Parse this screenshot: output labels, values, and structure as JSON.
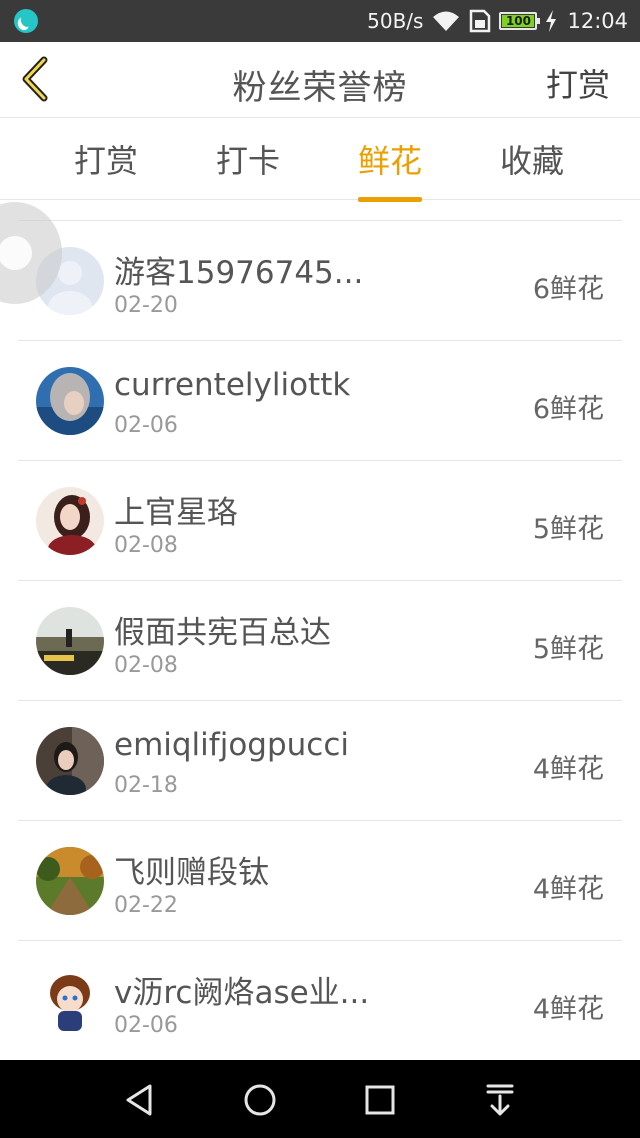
{
  "status_bar": {
    "speed": "50B/s",
    "battery": "100",
    "time": "12:04",
    "icons": [
      "app-notification-icon",
      "wifi-icon",
      "sim-icon",
      "battery-icon",
      "charging-icon"
    ]
  },
  "header": {
    "title": "粉丝荣誉榜",
    "action_label": "打赏",
    "back_icon": "chevron-left-icon"
  },
  "tabs": [
    {
      "label": "打赏",
      "active": false
    },
    {
      "label": "打卡",
      "active": false
    },
    {
      "label": "鲜花",
      "active": true
    },
    {
      "label": "收藏",
      "active": false
    }
  ],
  "colors": {
    "accent": "#e9a000",
    "status_bar": "#3a3a3a",
    "nav_bar": "#000000"
  },
  "rows": [
    {
      "name": "游客15976745...",
      "date": "02-20",
      "count": "6鲜花"
    },
    {
      "name": "currentelyliottk",
      "date": "02-06",
      "count": "6鲜花"
    },
    {
      "name": "上官星珞",
      "date": "02-08",
      "count": "5鲜花"
    },
    {
      "name": "假面共宪百总达",
      "date": "02-08",
      "count": "5鲜花"
    },
    {
      "name": "emiqlifjogpucci",
      "date": "02-18",
      "count": "4鲜花"
    },
    {
      "name": "飞则赠段钛",
      "date": "02-22",
      "count": "4鲜花"
    },
    {
      "name": "v沥rc阙烙ase业...",
      "date": "02-06",
      "count": "4鲜花"
    }
  ],
  "nav": [
    "back-triangle-icon",
    "home-circle-icon",
    "recents-square-icon",
    "notification-pull-icon"
  ]
}
